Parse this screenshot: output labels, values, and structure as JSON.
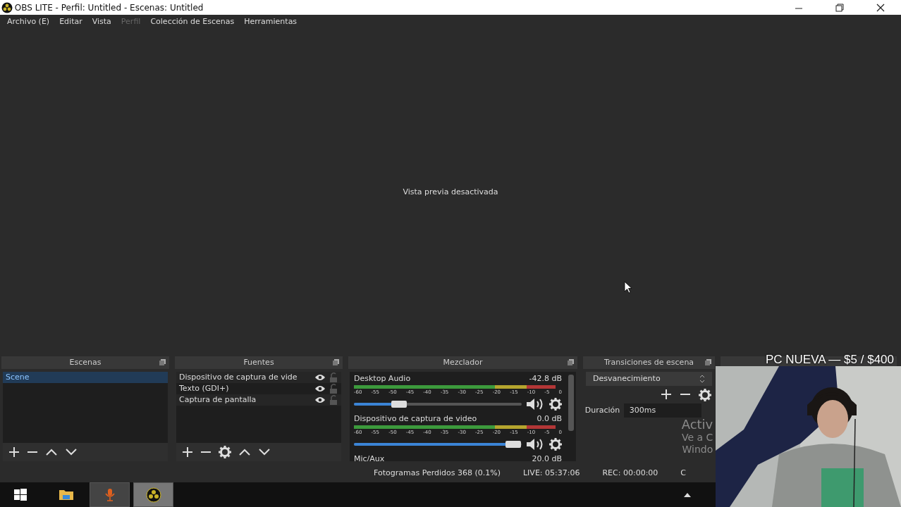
{
  "window": {
    "title": "OBS LITE - Perfil: Untitled - Escenas: Untitled"
  },
  "menu": [
    {
      "label": "Archivo (E)",
      "disabled": false
    },
    {
      "label": "Editar",
      "disabled": false
    },
    {
      "label": "Vista",
      "disabled": false
    },
    {
      "label": "Perfil",
      "disabled": true
    },
    {
      "label": "Colección de Escenas",
      "disabled": false
    },
    {
      "label": "Herramientas",
      "disabled": false
    }
  ],
  "preview": {
    "message": "Vista previa desactivada"
  },
  "scenes": {
    "title": "Escenas",
    "items": [
      {
        "label": "Scene",
        "selected": true
      }
    ]
  },
  "sources": {
    "title": "Fuentes",
    "items": [
      {
        "label": "Dispositivo de captura de vide",
        "visible": true,
        "locked": false
      },
      {
        "label": "Texto (GDI+)",
        "visible": true,
        "locked": false
      },
      {
        "label": "Captura de pantalla",
        "visible": true,
        "locked": false
      }
    ]
  },
  "mixer": {
    "title": "Mezclador",
    "channels": [
      {
        "name": "Desktop Audio",
        "reading": "-42.8 dB",
        "level": 0.27,
        "scale": [
          "-60",
          "-55",
          "-50",
          "-45",
          "-40",
          "-35",
          "-30",
          "-25",
          "-20",
          "-15",
          "-10",
          "-5",
          "0"
        ]
      },
      {
        "name": "Dispositivo de captura de video",
        "reading": "0.0 dB",
        "level": 0.95,
        "scale": [
          "-60",
          "-55",
          "-50",
          "-45",
          "-40",
          "-35",
          "-30",
          "-25",
          "-20",
          "-15",
          "-10",
          "-5",
          "0"
        ]
      },
      {
        "name": "Mic/Aux",
        "reading": "20.0 dB"
      }
    ]
  },
  "transitions": {
    "title": "Transiciones de escena",
    "selected_transition": "Desvanecimiento",
    "duration_label": "Duración",
    "duration": "300ms"
  },
  "activation_notice": [
    "Activ",
    "Ve a C",
    "Windo"
  ],
  "status_bar": {
    "dropped_frames": "Fotogramas Perdidos 368 (0.1%)",
    "live": "LIVE: 05:37:06",
    "rec": "REC: 00:00:00",
    "cut": "C"
  },
  "stream_overlay": {
    "text": "PC NUEVA — $5 / $400"
  },
  "webcam": {
    "kind": "picture"
  },
  "taskbar": {
    "apps": [
      {
        "kind": "windows",
        "open": false,
        "selected": false
      },
      {
        "kind": "folder",
        "open": false,
        "selected": false
      },
      {
        "kind": "microphone",
        "open": true,
        "selected": false
      },
      {
        "kind": "obs",
        "open": true,
        "selected": true
      }
    ]
  }
}
